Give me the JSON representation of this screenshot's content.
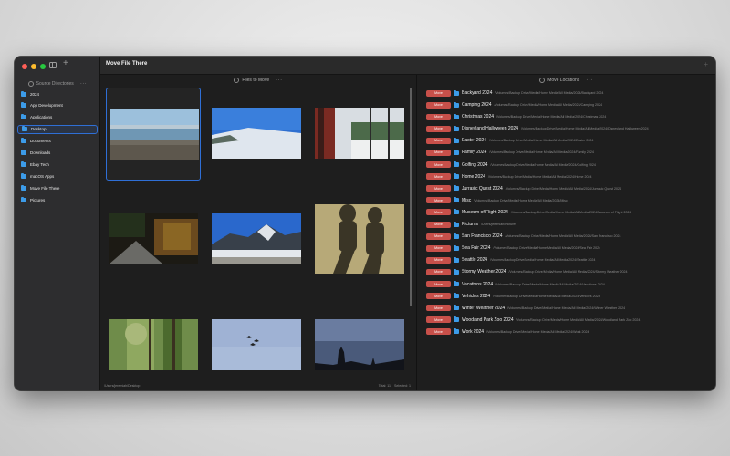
{
  "window": {
    "title": "Move File There",
    "add_symbol": "+"
  },
  "sidebar": {
    "header": "Source Directories",
    "more": "···",
    "add_symbol": "+",
    "items": [
      {
        "label": "2024",
        "selected": false
      },
      {
        "label": "App Development",
        "selected": false
      },
      {
        "label": "Applications",
        "selected": false
      },
      {
        "label": "Desktop",
        "selected": true
      },
      {
        "label": "Documents",
        "selected": false
      },
      {
        "label": "Downloads",
        "selected": false
      },
      {
        "label": "Ebay Tech",
        "selected": false
      },
      {
        "label": "macOS Apps",
        "selected": false
      },
      {
        "label": "Move File There",
        "selected": false
      },
      {
        "label": "Pictures",
        "selected": false
      }
    ]
  },
  "files": {
    "header": "Files to Move",
    "more": "···",
    "thumbnails": [
      {
        "name": "beach-lake-photo",
        "selected": true
      },
      {
        "name": "snowy-slope-photo",
        "selected": false
      },
      {
        "name": "window-view-photo",
        "selected": false
      },
      {
        "name": "forest-trail-photo",
        "selected": false
      },
      {
        "name": "ski-mountain-photo",
        "selected": false
      },
      {
        "name": "shadows-photo",
        "selected": false
      },
      {
        "name": "tree-canopy-photo",
        "selected": false
      },
      {
        "name": "jets-sky-photo",
        "selected": false
      },
      {
        "name": "dusk-trees-photo",
        "selected": false
      }
    ],
    "status": {
      "path": "/Users/jeremiah/Desktop",
      "total": "Total: 11",
      "selected": "Selected: 1"
    }
  },
  "moves": {
    "header": "Move Locations",
    "more": "···",
    "button_label": "Move",
    "items": [
      {
        "name": "Backyard 2024",
        "path": "/Volumes/Backup Drive/Media/Home Media/All Media/2024/Backyard 2024"
      },
      {
        "name": "Camping 2024",
        "path": "/Volumes/Backup Drive/Media/Home Media/All Media/2024/Camping 2024"
      },
      {
        "name": "Christmas 2024",
        "path": "/Volumes/Backup Drive/Media/Home Media/All Media/2024/Christmas 2024"
      },
      {
        "name": "Disneyland Halloween 2024",
        "path": "/Volumes/Backup Drive/Media/Home Media/All Media/2024/Disneyland Halloween 2024"
      },
      {
        "name": "Easter 2024",
        "path": "/Volumes/Backup Drive/Media/Home Media/All Media/2024/Easter 2024"
      },
      {
        "name": "Family 2024",
        "path": "/Volumes/Backup Drive/Media/Home Media/All Media/2024/Family 2024"
      },
      {
        "name": "Golfing 2024",
        "path": "/Volumes/Backup Drive/Media/Home Media/All Media/2024/Golfing 2024"
      },
      {
        "name": "Home 2024",
        "path": "/Volumes/Backup Drive/Media/Home Media/All Media/2024/Home 2024"
      },
      {
        "name": "Jurrasic Quest 2024",
        "path": "/Volumes/Backup Drive/Media/Home Media/All Media/2024/Jurrasic Quest 2024"
      },
      {
        "name": "Misc",
        "path": "/Volumes/Backup Drive/Media/Home Media/All Media/2024/Misc"
      },
      {
        "name": "Museum of Flight 2024",
        "path": "/Volumes/Backup Drive/Media/Home Media/All Media/2024/Museum of Flight 2024"
      },
      {
        "name": "Pictures",
        "path": "/Users/jeremiah/Pictures"
      },
      {
        "name": "San Francisco 2024",
        "path": "/Volumes/Backup Drive/Media/Home Media/All Media/2024/San Francisco 2024"
      },
      {
        "name": "Sea Fair 2024",
        "path": "/Volumes/Backup Drive/Media/Home Media/All Media/2024/Sea Fair 2024"
      },
      {
        "name": "Seattle 2024",
        "path": "/Volumes/Backup Drive/Media/Home Media/All Media/2024/Seattle 2024"
      },
      {
        "name": "Stormy Weather 2024",
        "path": "/Volumes/Backup Drive/Media/Home Media/All Media/2024/Stormy Weather 2024"
      },
      {
        "name": "Vacations 2024",
        "path": "/Volumes/Backup Drive/Media/Home Media/All Media/2024/Vacations 2024"
      },
      {
        "name": "Vehicles 2024",
        "path": "/Volumes/Backup Drive/Media/Home Media/All Media/2024/Vehicles 2024"
      },
      {
        "name": "Winter Weather 2024",
        "path": "/Volumes/Backup Drive/Media/Home Media/All Media/2024/Winter Weather 2024"
      },
      {
        "name": "Woodland Park Zoo 2024",
        "path": "/Volumes/Backup Drive/Media/Home Media/All Media/2024/Woodland Park Zoo 2024"
      },
      {
        "name": "Work 2024",
        "path": "/Volumes/Backup Drive/Media/Home Media/All Media/2024/Work 2024"
      }
    ]
  },
  "colors": {
    "accent": "#2f6fd6",
    "move_button": "#c8504a",
    "folder": "#3c9be8"
  }
}
